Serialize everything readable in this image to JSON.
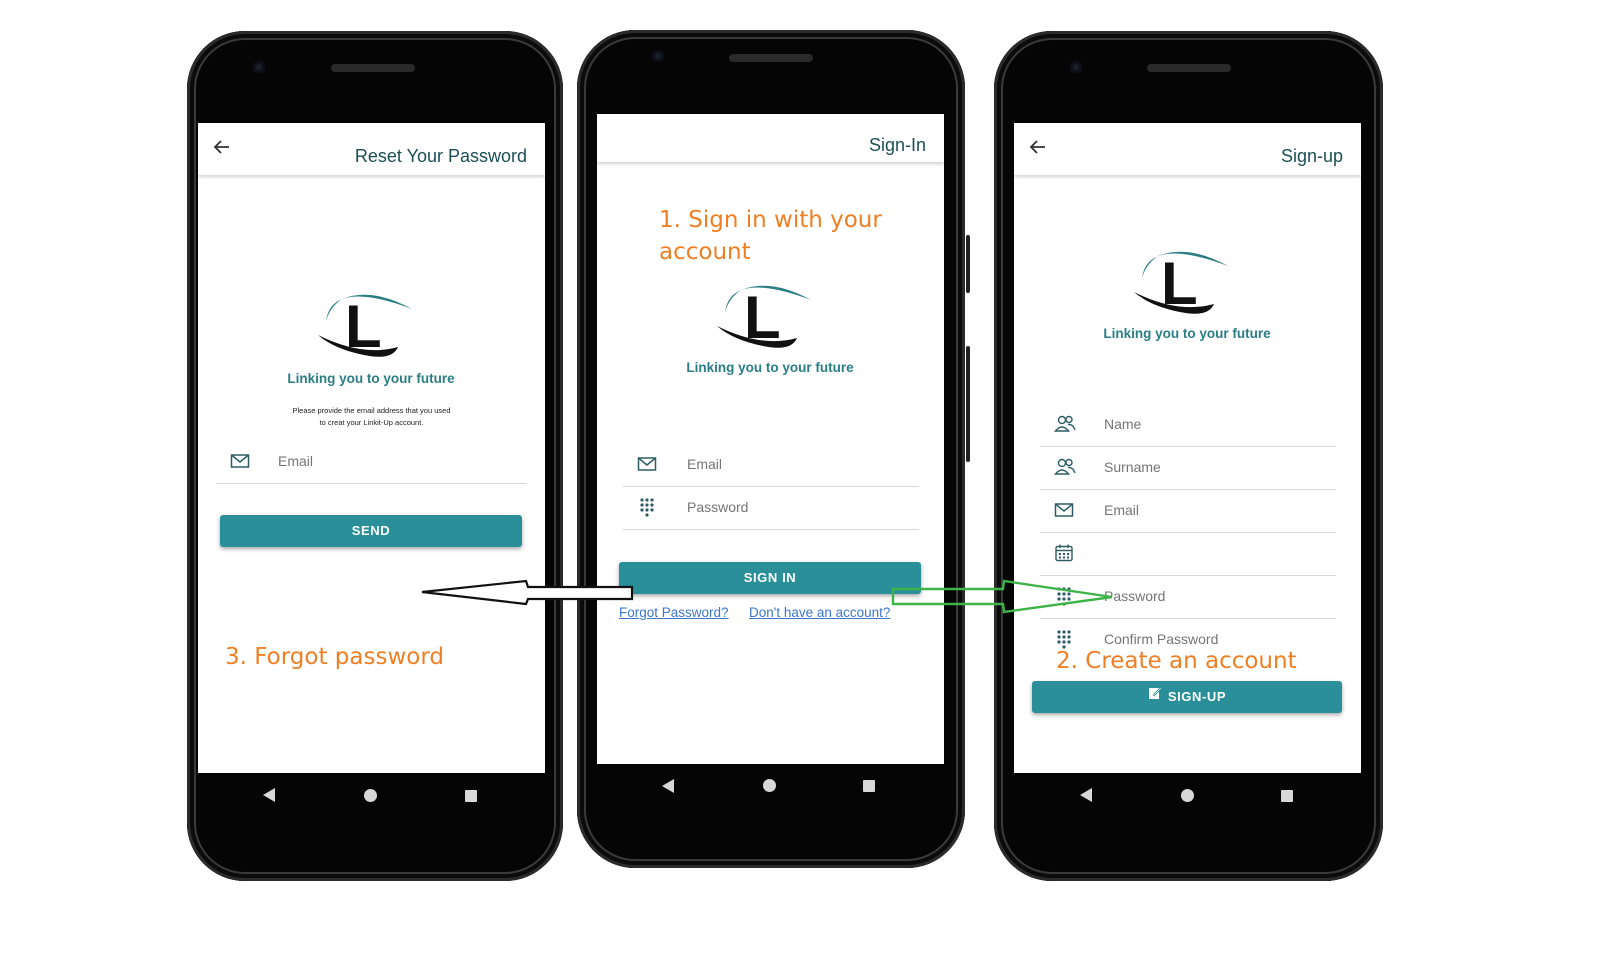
{
  "brand": {
    "tagline": "Linking you to your future",
    "logo_letter": "L",
    "accent": "#2a8f99",
    "title_color": "#1b4f55",
    "annotation_color": "#f07f24"
  },
  "reset_screen": {
    "title": "Reset Your Password",
    "back_icon": "arrow-left-icon",
    "instructions_line1": "Please provide the email address that you used",
    "instructions_line2": "to creat your Linkit-Up account.",
    "email_placeholder": "Email",
    "send_label": "SEND"
  },
  "signin_screen": {
    "title": "Sign-In",
    "email_placeholder": "Email",
    "password_placeholder": "Password",
    "signin_label": "SIGN IN",
    "forgot_link": "Forgot Password?",
    "signup_link": "Don't have an account?"
  },
  "signup_screen": {
    "title": "Sign-up",
    "back_icon": "arrow-left-icon",
    "fields": [
      {
        "icon": "people-icon",
        "placeholder": "Name"
      },
      {
        "icon": "people-icon",
        "placeholder": "Surname"
      },
      {
        "icon": "mail-icon",
        "placeholder": "Email"
      },
      {
        "icon": "calendar-icon",
        "placeholder": ""
      },
      {
        "icon": "keypad-icon",
        "placeholder": "Password"
      },
      {
        "icon": "keypad-icon",
        "placeholder": "Confirm Password"
      }
    ],
    "signup_label": "SIGN-UP",
    "signup_icon": "edit-icon"
  },
  "annotations": {
    "step1_line1": "1. Sign in with your",
    "step1_line2": "account",
    "step2": "2. Create an account",
    "step3": "3. Forgot password"
  }
}
